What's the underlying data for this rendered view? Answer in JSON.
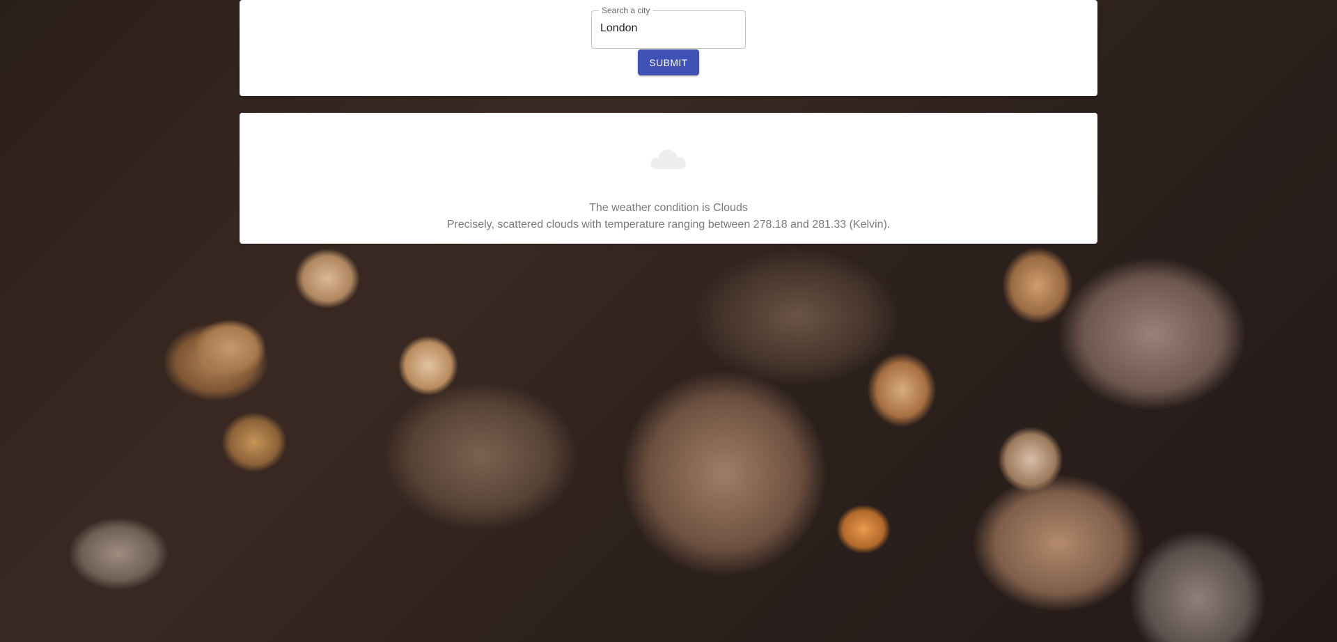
{
  "search": {
    "label": "Search a city",
    "value": "London",
    "submit_label": "SUBMIT"
  },
  "result": {
    "icon": "cloud-icon",
    "condition_text": "The weather condition is Clouds",
    "detail_text": "Precisely, scattered clouds with temperature ranging between 278.18 and 281.33 (Kelvin)."
  },
  "colors": {
    "accent": "#3f51b5",
    "card_background": "#ffffff",
    "muted_text": "#7a7a7a",
    "icon_gray": "#eeeeee"
  }
}
